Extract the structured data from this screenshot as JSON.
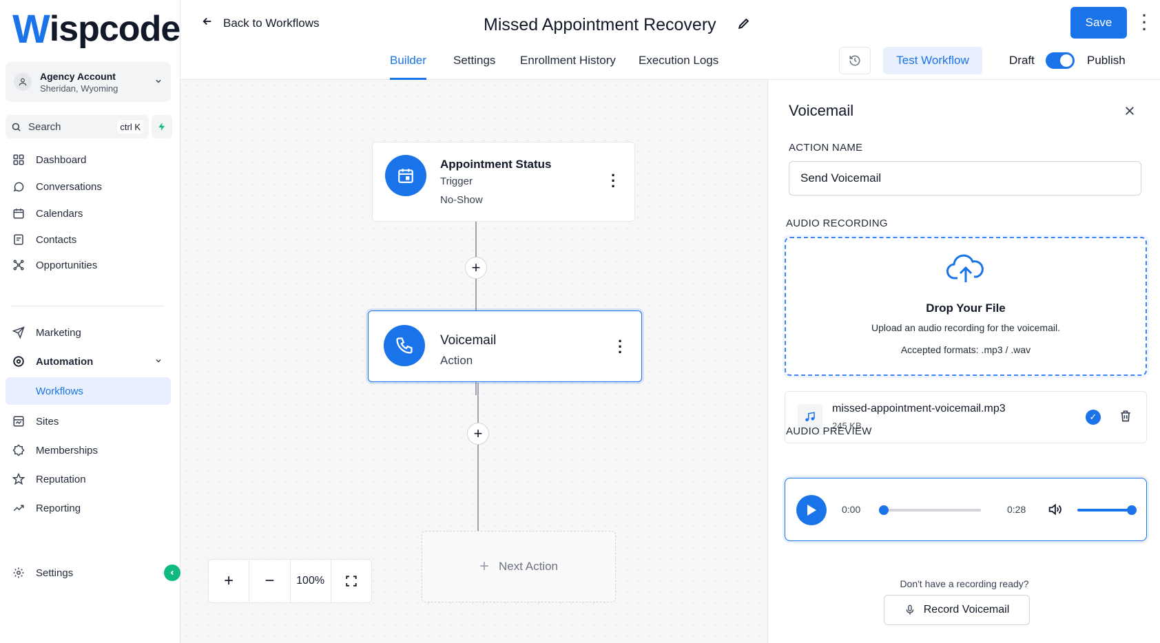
{
  "brand": {
    "logo_w": "W",
    "logo_rest": "ispcode"
  },
  "account": {
    "name": "Agency Account",
    "location": "Sheridan, Wyoming"
  },
  "search": {
    "label": "Search",
    "shortcut": "ctrl K"
  },
  "nav": {
    "dashboard": "Dashboard",
    "conversations": "Conversations",
    "calendars": "Calendars",
    "contacts": "Contacts",
    "opportunities": "Opportunities",
    "marketing": "Marketing",
    "automation": "Automation",
    "workflows": "Workflows",
    "sites": "Sites",
    "memberships": "Memberships",
    "reputation": "Reputation",
    "reporting": "Reporting",
    "settings": "Settings"
  },
  "header": {
    "back": "Back to Workflows",
    "title": "Missed Appointment Recovery",
    "tabs": [
      "Builder",
      "Settings",
      "Enrollment History",
      "Execution Logs"
    ],
    "test": "Test Workflow",
    "draft": "Draft",
    "publish": "Publish",
    "save": "Save",
    "published": true
  },
  "canvas": {
    "trigger": {
      "title": "Appointment Status",
      "type": "Trigger",
      "detail": "No-Show"
    },
    "action": {
      "title": "Voicemail",
      "type": "Action"
    },
    "next_action": "Next Action",
    "zoom": "100%"
  },
  "panel": {
    "title": "Voicemail",
    "action_name_label": "ACTION NAME",
    "action_name_value": "Send Voicemail",
    "audio_label": "AUDIO RECORDING",
    "drop_title": "Drop Your File",
    "drop_sub": "Upload an audio recording for the voicemail.",
    "drop_formats": "Accepted formats: .mp3 / .wav",
    "file_name": "missed-appointment-voicemail.mp3",
    "file_size": "245 KB",
    "preview_label": "AUDIO PREVIEW",
    "time_current": "0:00",
    "time_total": "0:28",
    "no_recording": "Don't have a recording ready?",
    "record_button": "Record Voicemail"
  },
  "colors": {
    "accent": "#1a73e8",
    "success": "#10b981"
  }
}
